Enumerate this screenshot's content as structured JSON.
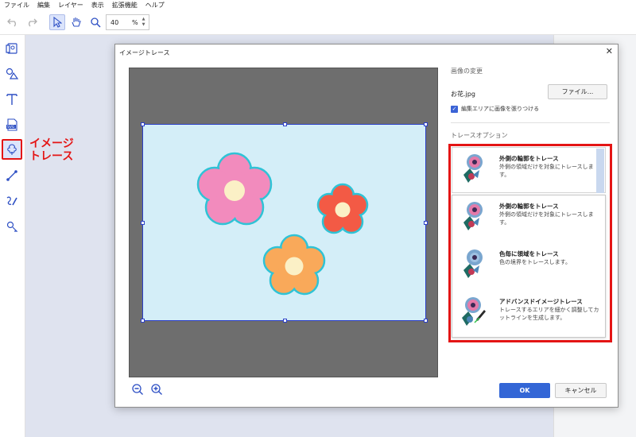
{
  "menu": [
    "ファイル",
    "編集",
    "レイヤー",
    "表示",
    "拡張機能",
    "ヘルプ"
  ],
  "toolbar": {
    "zoom_value": "40",
    "zoom_unit": "%"
  },
  "left_tools": [
    "image-import-icon",
    "shapes-icon",
    "text-icon",
    "svg-icon",
    "image-trace-icon",
    "line-icon",
    "pen-icon",
    "node-icon"
  ],
  "callout": {
    "line1": "イメージ",
    "line2": "トレース"
  },
  "dialog": {
    "title": "イメージトレース",
    "close": "✕",
    "image_change_title": "画像の変更",
    "filename": "お花.jpg",
    "file_button": "ファイル...",
    "paste_checkbox_label": "編集エリアに画像を張りつける",
    "trace_options_title": "トレースオプション",
    "selected_option": {
      "name": "外側の輪郭をトレース",
      "desc": "外側の領域だけを対象にトレースします。"
    },
    "options": [
      {
        "name": "外側の輪郭をトレース",
        "desc": "外側の領域だけを対象にトレースします。"
      },
      {
        "name": "色毎に領域をトレース",
        "desc": "色の境界をトレースします。"
      },
      {
        "name": "アドバンスドイメージトレース",
        "desc": "トレースするエリアを細かく調整してカットラインを生成します。"
      }
    ],
    "ok": "OK",
    "cancel": "キャンセル"
  },
  "colors": {
    "accent": "#3366d6",
    "highlight": "#e41515",
    "canvas_bg": "#6e6e6e",
    "image_bg": "#d4eef8"
  }
}
